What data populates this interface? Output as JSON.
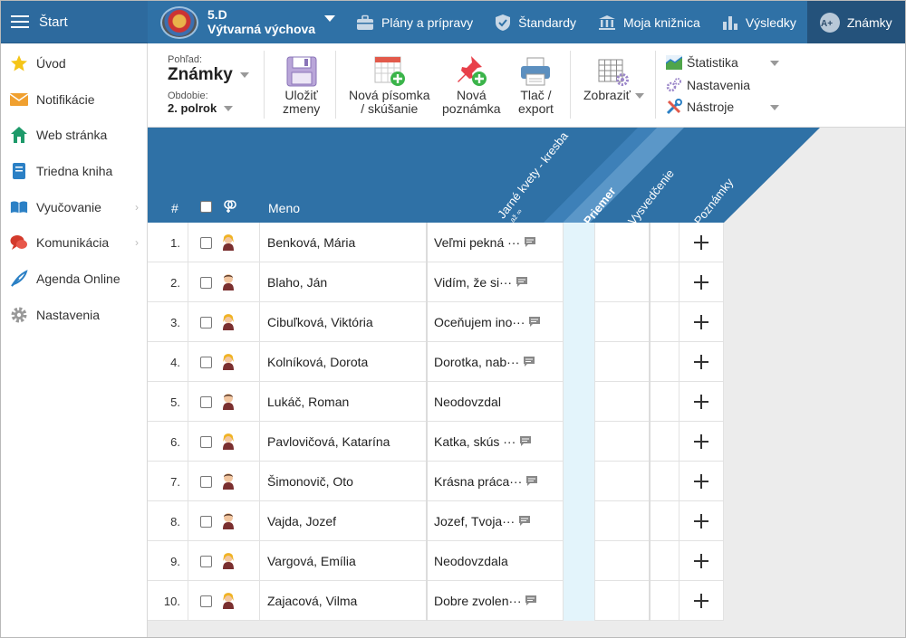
{
  "topbar": {
    "start_label": "Štart",
    "class_code": "5.D",
    "class_subject": "Výtvarná výchova",
    "tabs": [
      {
        "label": "Plány a prípravy",
        "icon": "briefcase-icon"
      },
      {
        "label": "Štandardy",
        "icon": "shield-check-icon"
      },
      {
        "label": "Moja knižnica",
        "icon": "library-icon"
      },
      {
        "label": "Výsledky",
        "icon": "bar-chart-icon"
      },
      {
        "label": "Známky",
        "icon": "grades-icon",
        "active": true
      }
    ]
  },
  "sidebar": {
    "items": [
      {
        "label": "Úvod",
        "icon": "star-icon"
      },
      {
        "label": "Notifikácie",
        "icon": "envelope-icon"
      },
      {
        "label": "Web stránka",
        "icon": "house-icon"
      },
      {
        "label": "Triedna kniha",
        "icon": "notebook-icon"
      },
      {
        "label": "Vyučovanie",
        "icon": "open-book-icon",
        "has_submenu": true
      },
      {
        "label": "Komunikácia",
        "icon": "chat-icon",
        "has_submenu": true
      },
      {
        "label": "Agenda Online",
        "icon": "feather-icon"
      },
      {
        "label": "Nastavenia",
        "icon": "gear-icon"
      }
    ]
  },
  "toolbar": {
    "view_label": "Pohľad:",
    "view_value": "Známky",
    "period_label": "Obdobie:",
    "period_value": "2. polrok",
    "save_line1": "Uložiť",
    "save_line2": "zmeny",
    "new_exam_line1": "Nová písomka",
    "new_exam_line2": "/ skúšanie",
    "new_note_line1": "Nová",
    "new_note_line2": "poznámka",
    "print_line1": "Tlač /",
    "print_line2": "export",
    "show_label": "Zobraziť",
    "statistics_label": "Štatistika",
    "settings_label": "Nastavenia",
    "tools_label": "Nástroje"
  },
  "grid": {
    "col_number": "#",
    "col_name": "Meno",
    "col_exam": "Jarné kvety - kresba",
    "col_exam_sub": "až ∞",
    "col_average": "Priemer",
    "col_certificate": "Vysvedčenie",
    "col_notes": "Poznámky",
    "rows": [
      {
        "n": "1.",
        "name": "Benková, Mária",
        "note": "Veľmi pekná ···",
        "gender": "female"
      },
      {
        "n": "2.",
        "name": "Blaho, Ján",
        "note": "Vidím, že si···",
        "gender": "male"
      },
      {
        "n": "3.",
        "name": "Cibuľková, Viktória",
        "note": "Oceňujem ino···",
        "gender": "female"
      },
      {
        "n": "4.",
        "name": "Kolníková, Dorota",
        "note": "Dorotka, nab···",
        "gender": "female"
      },
      {
        "n": "5.",
        "name": "Lukáč, Roman",
        "note": "Neodovzdal",
        "gender": "male"
      },
      {
        "n": "6.",
        "name": "Pavlovičová, Katarína",
        "note": "Katka, skús ···",
        "gender": "female"
      },
      {
        "n": "7.",
        "name": "Šimonovič, Oto",
        "note": "Krásna práca···",
        "gender": "male"
      },
      {
        "n": "8.",
        "name": "Vajda, Jozef",
        "note": "Jozef, Tvoja···",
        "gender": "male"
      },
      {
        "n": "9.",
        "name": "Vargová, Emília",
        "note": "Neodovzdala",
        "gender": "female"
      },
      {
        "n": "10.",
        "name": "Zajacová, Vilma",
        "note": "Dobre zvolen···",
        "gender": "female"
      }
    ]
  },
  "colors": {
    "primary": "#2f71a6",
    "active_tab": "#24527b",
    "average_bg": "#e3f4fb"
  }
}
